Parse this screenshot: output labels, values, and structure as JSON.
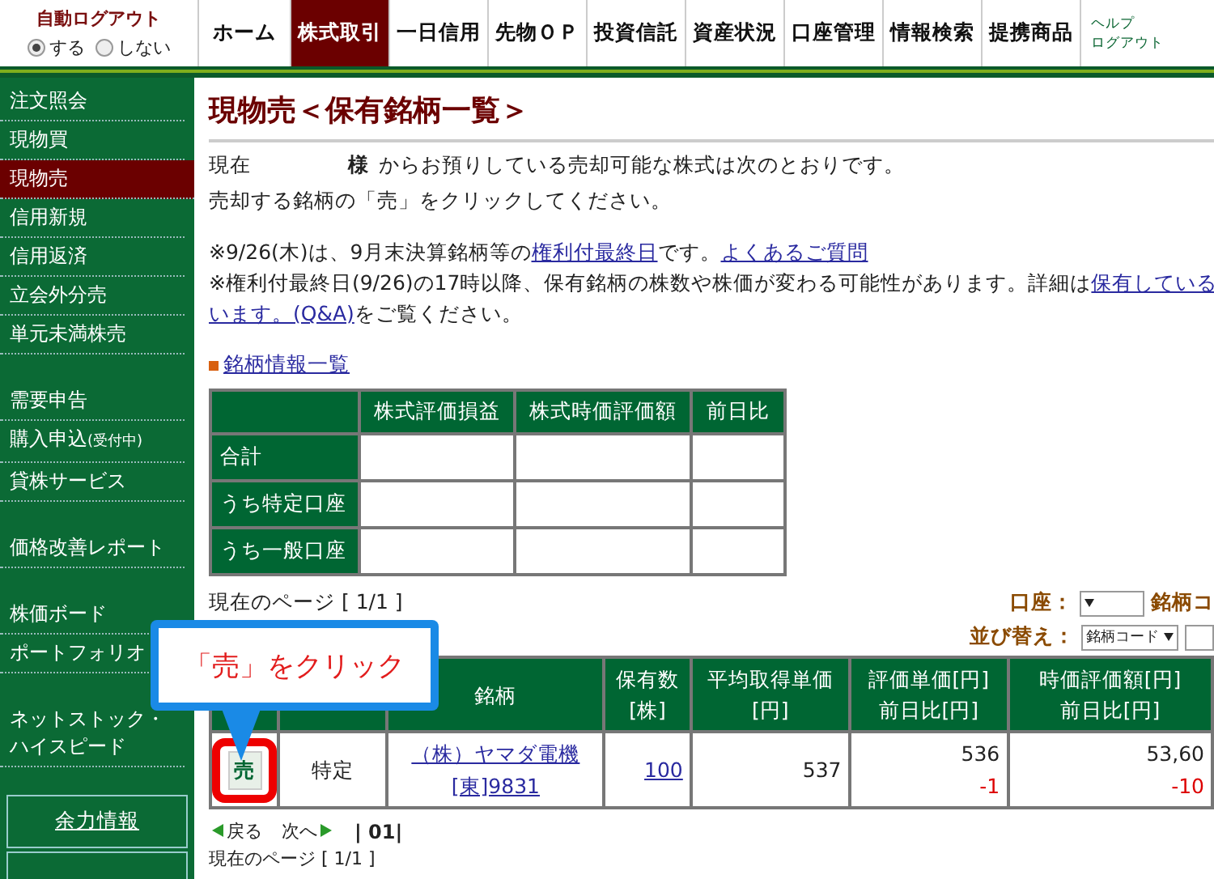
{
  "auto_logout": {
    "title": "自動ログアウト",
    "options": [
      {
        "label": "する",
        "selected": true
      },
      {
        "label": "しない",
        "selected": false
      }
    ]
  },
  "nav": [
    {
      "label": "ホーム",
      "selected": false
    },
    {
      "label": "株式取引",
      "selected": true
    },
    {
      "label": "一日信用",
      "selected": false
    },
    {
      "label": "先物ＯＰ",
      "selected": false
    },
    {
      "label": "投資信託",
      "selected": false
    },
    {
      "label": "資産状況",
      "selected": false
    },
    {
      "label": "口座管理",
      "selected": false
    },
    {
      "label": "情報検索",
      "selected": false
    },
    {
      "label": "提携商品",
      "selected": false
    }
  ],
  "nav_links": [
    "ヘルプ",
    "ログアウト"
  ],
  "sidebar": {
    "groups": [
      [
        {
          "label": "注文照会",
          "selected": false
        },
        {
          "label": "現物買",
          "selected": false
        },
        {
          "label": "現物売",
          "selected": true
        },
        {
          "label": "信用新規",
          "selected": false
        },
        {
          "label": "信用返済",
          "selected": false
        },
        {
          "label": "立会外分売",
          "selected": false
        },
        {
          "label": "単元未満株売",
          "selected": false
        }
      ],
      [
        {
          "label": "需要申告",
          "selected": false
        },
        {
          "label": "購入申込",
          "note": "(受付中)",
          "selected": false
        },
        {
          "label": "貸株サービス",
          "selected": false
        }
      ],
      [
        {
          "label": "価格改善レポート",
          "selected": false
        }
      ],
      [
        {
          "label": "株価ボード",
          "selected": false
        },
        {
          "label": "ポートフォリオ",
          "selected": false
        }
      ],
      [
        {
          "label": "ネットストック・ハイスピード",
          "selected": false
        }
      ]
    ],
    "button": "余力情報"
  },
  "title": "現物売＜保有銘柄一覧＞",
  "intro": [
    {
      "parts": [
        {
          "text": "現在"
        },
        {
          "text": "様",
          "bold": true
        },
        {
          "text": "からお預りしている売却可能な株式は次のとおりです。"
        }
      ]
    },
    {
      "parts": [
        {
          "text": "売却する銘柄の「売」をクリックしてください。"
        }
      ]
    }
  ],
  "notices": [
    {
      "parts": [
        {
          "text": "※9/26(木)は、9月末決算銘柄等の"
        },
        {
          "text": "権利付最終日",
          "link": true
        },
        {
          "text": "です。"
        },
        {
          "text": "よくあるご質問",
          "link": true
        }
      ]
    },
    {
      "parts": [
        {
          "text": "※権利付最終日(9/26)の17時以降、保有銘柄の株数や株価が変わる可能性があります。詳細は"
        },
        {
          "text": "保有している",
          "link": true
        }
      ]
    },
    {
      "parts": [
        {
          "text": "います。(Q&A)",
          "link": true
        },
        {
          "text": "をご覧ください。"
        }
      ]
    }
  ],
  "info_link": "銘柄情報一覧",
  "summary": {
    "columns": [
      "株式評価損益",
      "株式時価評価額",
      "前日比"
    ],
    "rows": [
      "合計",
      "うち特定口座",
      "うち一般口座"
    ]
  },
  "page_info": "現在のページ [ 1/1 ]",
  "filters": [
    {
      "label": "口座：",
      "after": "銘柄コ"
    },
    {
      "label": "並び替え：",
      "value": "銘柄コード"
    }
  ],
  "holdings": {
    "columns": [
      [
        "銘柄"
      ],
      [
        "保有数",
        "[株]"
      ],
      [
        "平均取得単価",
        "[円]"
      ],
      [
        "評価単価[円]",
        "前日比[円]"
      ],
      [
        "時価評価額[円]",
        "前日比[円]"
      ]
    ],
    "rows": [
      {
        "action": "売",
        "account": "特定",
        "name": "（株）ヤマダ電機",
        "code": "[東]9831",
        "quantity": "100",
        "avg_price": "537",
        "price": "536",
        "price_change": "-1",
        "value": "53,60",
        "value_change": "-10"
      }
    ]
  },
  "pager": {
    "prev": "戻る",
    "next": "次へ",
    "pages": "| 01|"
  },
  "page_info_bottom": "現在のページ [ 1/1 ]",
  "callout": "「売」をクリック"
}
